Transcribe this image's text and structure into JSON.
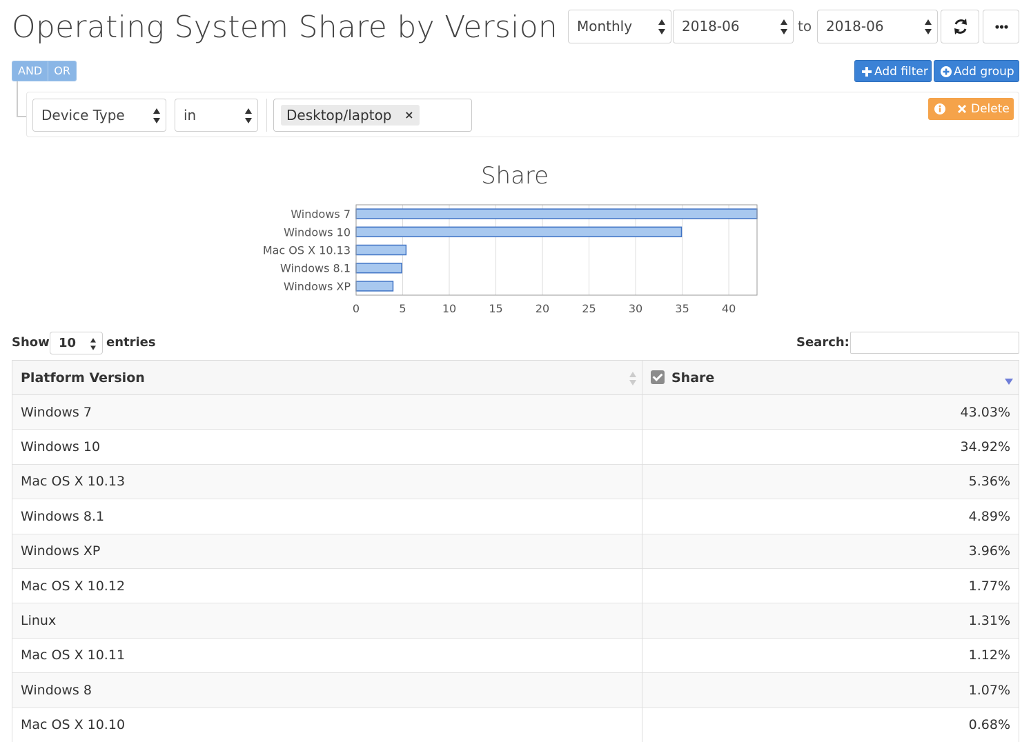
{
  "header": {
    "title": "Operating System Share by Version",
    "period_select": "Monthly",
    "from_date": "2018-06",
    "to_label": "to",
    "to_date": "2018-06"
  },
  "builder": {
    "and_label": "AND",
    "or_label": "OR",
    "add_filter_label": "Add filter",
    "add_group_label": "Add group",
    "rule": {
      "field": "Device Type",
      "operator": "in",
      "value_tag": "Desktop/laptop",
      "tag_remove": "×"
    },
    "delete_label": "Delete"
  },
  "chart_data": {
    "type": "bar",
    "orientation": "horizontal",
    "title": "Share",
    "categories": [
      "Windows 7",
      "Windows 10",
      "Mac OS X 10.13",
      "Windows 8.1",
      "Windows XP"
    ],
    "values": [
      43.03,
      34.92,
      5.36,
      4.89,
      3.96
    ],
    "x_ticks": [
      "0",
      "5",
      "10",
      "15",
      "20",
      "25",
      "30",
      "35",
      "40"
    ],
    "xlim": [
      0,
      43.03
    ],
    "grid": true,
    "bar_color": "#a8c8ef",
    "bar_border": "#3f72c4"
  },
  "table": {
    "show_label": "Show",
    "page_size": "10",
    "entries_label": "entries",
    "search_label": "Search:",
    "columns": [
      "Platform Version",
      "Share"
    ],
    "rows": [
      [
        "Windows 7",
        "43.03%"
      ],
      [
        "Windows 10",
        "34.92%"
      ],
      [
        "Mac OS X 10.13",
        "5.36%"
      ],
      [
        "Windows 8.1",
        "4.89%"
      ],
      [
        "Windows XP",
        "3.96%"
      ],
      [
        "Mac OS X 10.12",
        "1.77%"
      ],
      [
        "Linux",
        "1.31%"
      ],
      [
        "Mac OS X 10.11",
        "1.12%"
      ],
      [
        "Windows 8",
        "1.07%"
      ],
      [
        "Mac OS X 10.10",
        "0.68%"
      ]
    ]
  }
}
